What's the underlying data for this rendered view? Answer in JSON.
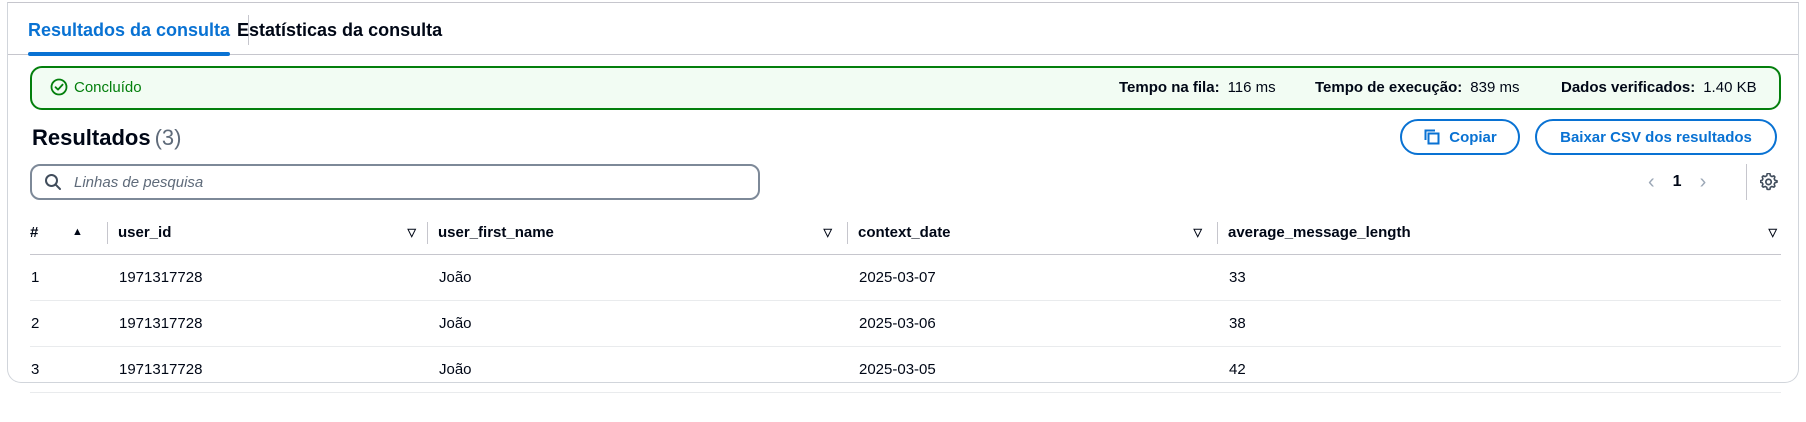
{
  "tabs": [
    {
      "label": "Resultados da consulta",
      "active": true
    },
    {
      "label": "Estatísticas da consulta",
      "active": false
    }
  ],
  "status": {
    "text": "Concluído",
    "queue_label": "Tempo na fila:",
    "queue_value": "116 ms",
    "exec_label": "Tempo de execução:",
    "exec_value": "839 ms",
    "scanned_label": "Dados verificados:",
    "scanned_value": "1.40 KB"
  },
  "results": {
    "title": "Resultados",
    "count": "(3)"
  },
  "actions": {
    "copy_label": "Copiar",
    "download_label": "Baixar CSV dos resultados"
  },
  "search": {
    "placeholder": "Linhas de pesquisa"
  },
  "pagination": {
    "current_page": "1"
  },
  "table": {
    "columns": [
      "#",
      "user_id",
      "user_first_name",
      "context_date",
      "average_message_length"
    ],
    "rows": [
      [
        "1",
        "1971317728",
        "João",
        "2025-03-07",
        "33"
      ],
      [
        "2",
        "1971317728",
        "João",
        "2025-03-06",
        "38"
      ],
      [
        "3",
        "1971317728",
        "João",
        "2025-03-05",
        "42"
      ]
    ]
  },
  "colors": {
    "accent": "#0972d3",
    "success": "#037f0c",
    "success_bg": "#f2fcf3"
  }
}
